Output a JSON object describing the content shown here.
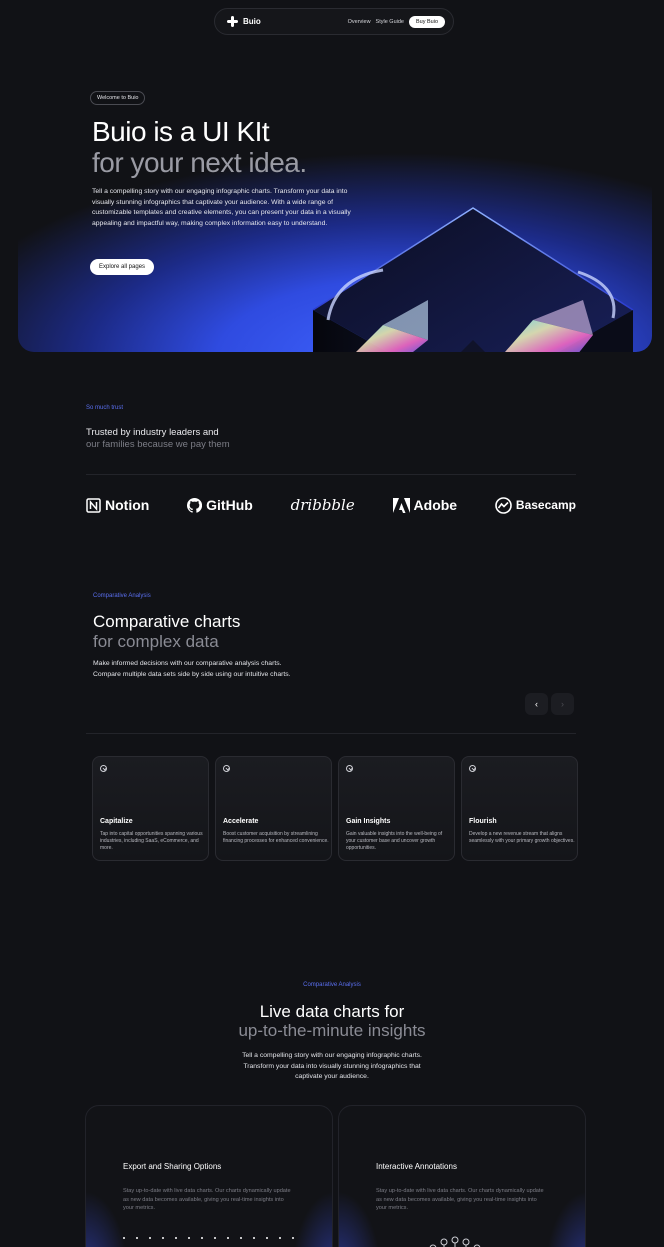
{
  "nav": {
    "brand": "Buio",
    "links": [
      "Overview",
      "Style Guide"
    ],
    "cta": "Buy Buio"
  },
  "hero": {
    "badge": "Welcome to Buio",
    "title_line1": "Buio is a UI KIt",
    "title_line2": "for your next idea.",
    "body": "Tell a compelling story with our engaging infographic charts. Transform your data into visually stunning infographics that captivate your audience. With a wide range of customizable templates and creative elements, you can present your data in a visually appealing and impactful way, making complex information easy to understand.",
    "cta": "Explore all pages"
  },
  "trust": {
    "eyebrow": "So much trust",
    "title_line1": "Trusted by industry leaders and",
    "title_line2": "our families because we pay them",
    "logos": [
      "Notion",
      "GitHub",
      "dribbble",
      "Adobe",
      "Basecamp"
    ]
  },
  "comparative": {
    "eyebrow": "Comparative Analysis",
    "title_line1": "Comparative charts",
    "title_line2": "for complex data",
    "body": "Make informed decisions with our comparative analysis charts. Compare multiple data sets side by side using our intuitive charts.",
    "prev_label": "‹",
    "next_label": "›",
    "cards": [
      {
        "title": "Capitalize",
        "body": "Tap into capital opportunities spanning various industries, including SaaS, eCommerce, and more."
      },
      {
        "title": "Accelerate",
        "body": "Boost customer acquisition by streamlining financing processes for enhanced convenience."
      },
      {
        "title": "Gain Insights",
        "body": "Gain valuable insights into the well-being of your customer base and uncover growth opportunities."
      },
      {
        "title": "Flourish",
        "body": "Develop a new revenue stream that aligns seamlessly with your primary growth objectives."
      }
    ]
  },
  "live": {
    "eyebrow": "Comparative Analysis",
    "title_line1": "Live data charts for",
    "title_line2": "up-to-the-minute insights",
    "body": "Tell a compelling story with our engaging infographic charts. Transform your data into visually stunning infographics that captivate your audience.",
    "features": [
      {
        "title": "Export and Sharing Options",
        "body": "Stay up-to-date with live data charts. Our charts dynamically update as new data becomes available, giving you real-time insights into your metrics."
      },
      {
        "title": "Interactive Annotations",
        "body": "Stay up-to-date with live data charts. Our charts dynamically update as new data becomes available, giving you real-time insights into your metrics."
      }
    ]
  },
  "colors": {
    "background": "#111216",
    "accent": "#5a6ff0",
    "hero_blue": "#3f63ff"
  }
}
